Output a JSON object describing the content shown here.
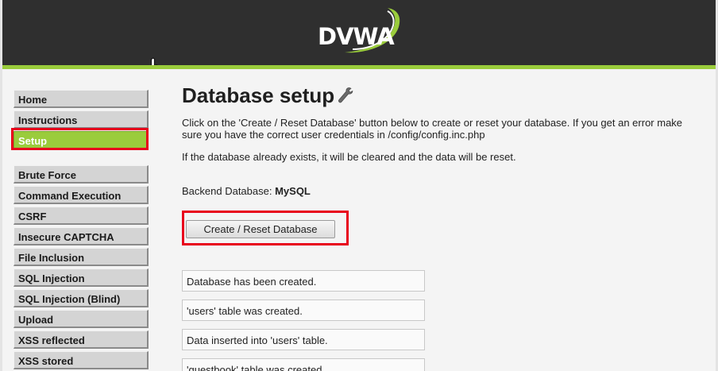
{
  "header": {
    "logo_text": "DVWA"
  },
  "sidebar": {
    "top_items": [
      {
        "label": "Home"
      },
      {
        "label": "Instructions"
      },
      {
        "label": "Setup"
      }
    ],
    "vuln_items": [
      {
        "label": "Brute Force"
      },
      {
        "label": "Command Execution"
      },
      {
        "label": "CSRF"
      },
      {
        "label": "Insecure CAPTCHA"
      },
      {
        "label": "File Inclusion"
      },
      {
        "label": "SQL Injection"
      },
      {
        "label": "SQL Injection (Blind)"
      },
      {
        "label": "Upload"
      },
      {
        "label": "XSS reflected"
      },
      {
        "label": "XSS stored"
      }
    ]
  },
  "main": {
    "title": "Database setup",
    "intro": "Click on the 'Create / Reset Database' button below to create or reset your database. If you get an error make sure you have the correct user credentials in /config/config.inc.php",
    "warning": "If the database already exists, it will be cleared and the data will be reset.",
    "backend_label": "Backend Database:",
    "backend_value": "MySQL",
    "create_button": "Create / Reset Database",
    "messages": [
      "Database has been created.",
      "'users' table was created.",
      "Data inserted into 'users' table.",
      "'guestbook' table was created."
    ]
  },
  "colors": {
    "accent": "#9acc3c",
    "header_bg": "#2f2f2f",
    "highlight": "#e8001c"
  }
}
